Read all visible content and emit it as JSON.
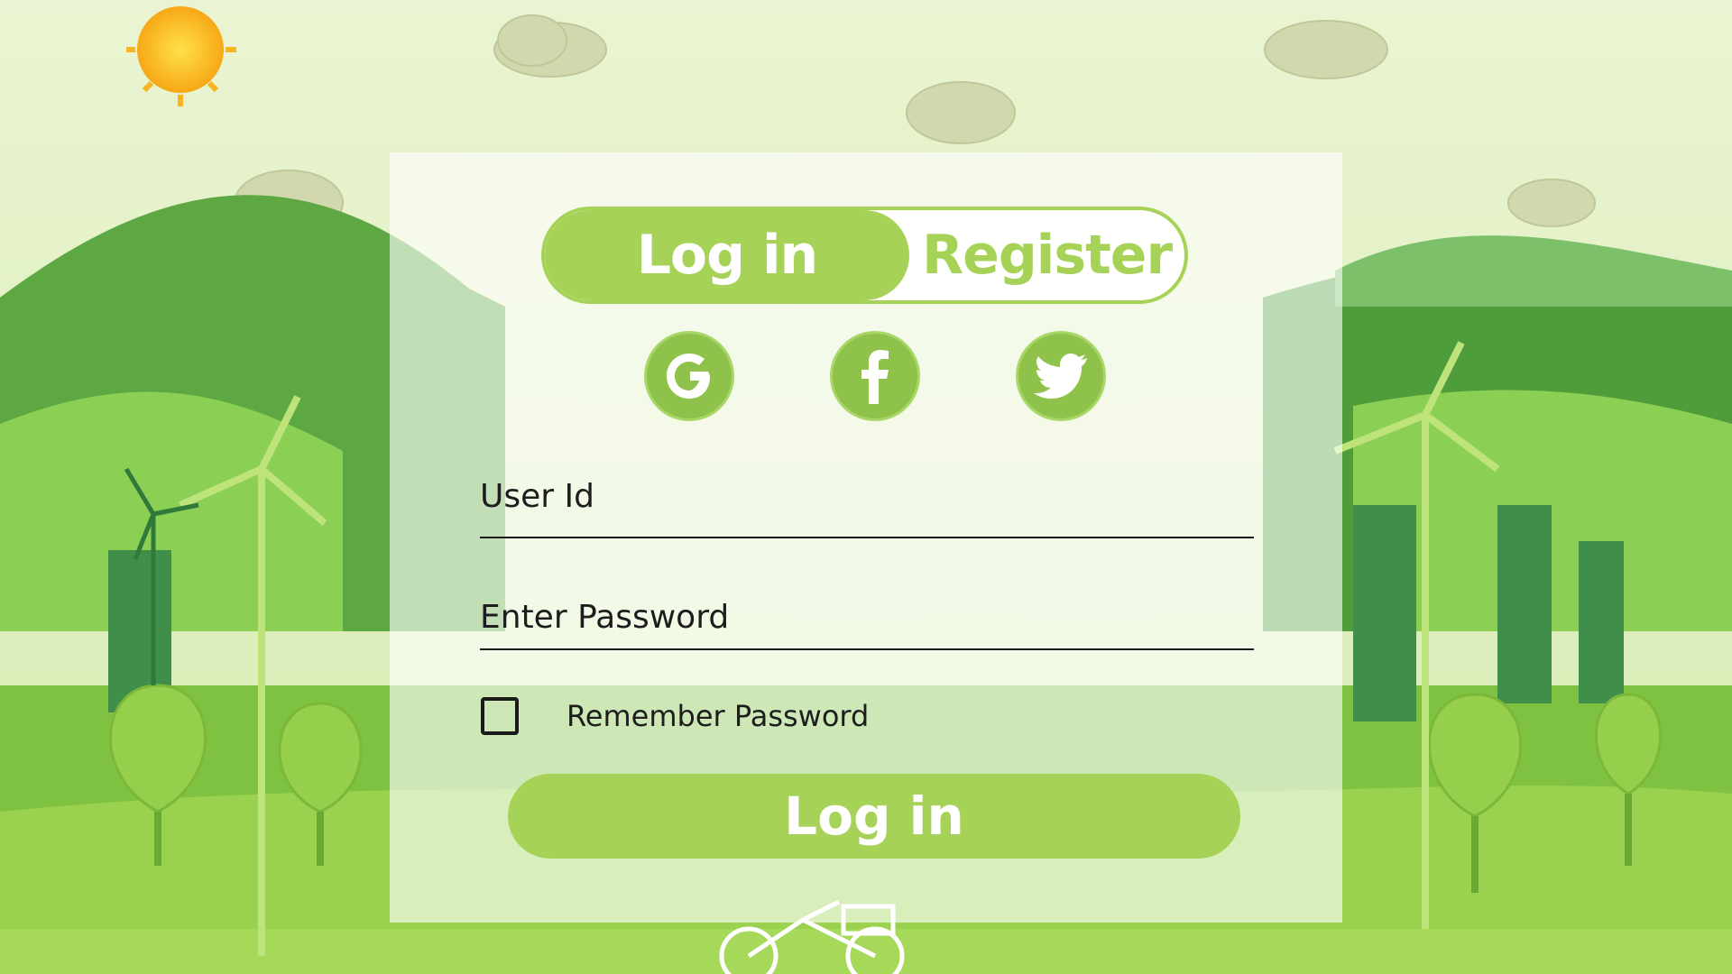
{
  "tabs": {
    "login_label": "Log in",
    "register_label": "Register"
  },
  "social": [
    {
      "icon": "google-icon"
    },
    {
      "icon": "facebook-icon"
    },
    {
      "icon": "twitter-icon"
    }
  ],
  "form": {
    "user_id_label": "User Id",
    "password_label": "Enter Password",
    "remember_label": "Remember Password",
    "remember_checked": false,
    "submit_label": "Log in"
  },
  "colors": {
    "accent": "#a7d258",
    "social_bg": "#8fc24a",
    "sky": "#e4f1c8",
    "hill_dark": "#4f9f3a",
    "hill_light": "#9fd05a"
  }
}
